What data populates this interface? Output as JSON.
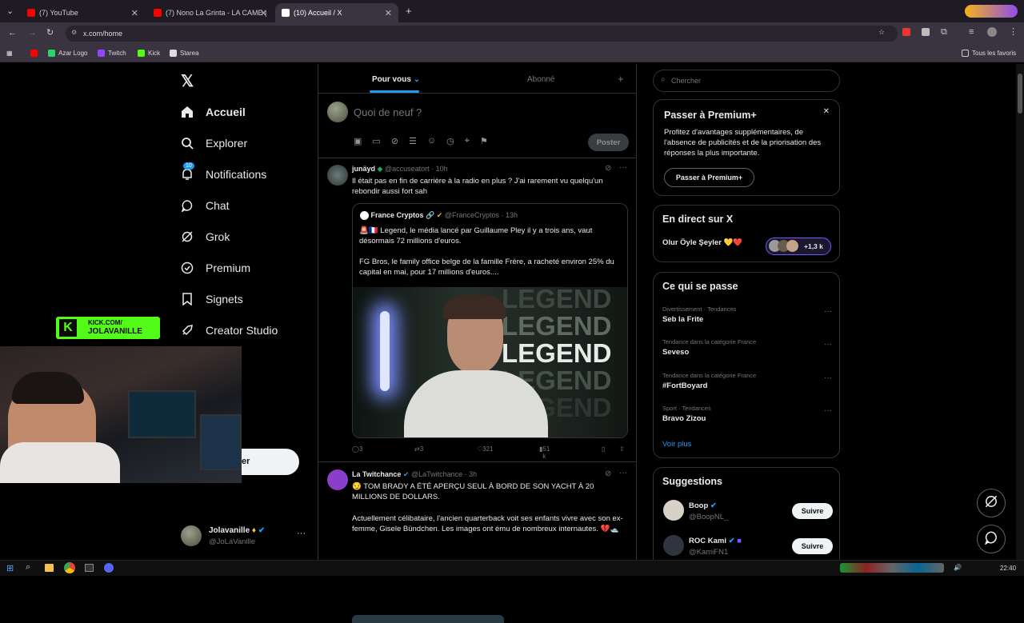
{
  "browser": {
    "tabs": [
      {
        "title": "(7) YouTube",
        "color": "#ff0000"
      },
      {
        "title": "(7) Nono La Grinta - LA CAME |",
        "color": "#ff0000"
      },
      {
        "title": "(10) Accueil / X",
        "color": "#ffffff"
      }
    ],
    "url": "x.com/home",
    "bookmarks": [
      "Azar Logo",
      "Twitch",
      "Kick",
      "Starea"
    ],
    "all_bookmarks": "Tous les favoris"
  },
  "nav": {
    "items": [
      {
        "label": "Accueil",
        "icon": "home-icon"
      },
      {
        "label": "Explorer",
        "icon": "search-icon"
      },
      {
        "label": "Notifications",
        "icon": "bell-icon",
        "badge": "10"
      },
      {
        "label": "Chat",
        "icon": "chat-icon"
      },
      {
        "label": "Grok",
        "icon": "grok-icon"
      },
      {
        "label": "Premium",
        "icon": "premium-icon"
      },
      {
        "label": "Signets",
        "icon": "bookmark-icon"
      },
      {
        "label": "Creator Studio",
        "icon": "rocket-icon"
      }
    ],
    "post_button_partial": "er",
    "account": {
      "name": "Jolavanille",
      "handle": "@JoLaVanille"
    }
  },
  "timeline": {
    "tabs": [
      "Pour vous",
      "Abonné"
    ],
    "compose_placeholder": "Quoi de neuf ?",
    "post_button": "Poster",
    "tweets": [
      {
        "name": "junäyd",
        "handle": "@accuseatort",
        "time": "· 10h",
        "text": "Il était pas en fin de carrière à la radio en plus ? J'ai rarement vu quelqu'un rebondir aussi fort sah",
        "quote": {
          "name": "France Cryptos",
          "handle": "@FranceCryptos",
          "time": "· 13h",
          "text1": "🚨🇫🇷 Legend, le média lancé par Guillaume Pley il y a trois ans, vaut désormais 72 millions d'euros.",
          "text2": "FG Bros, le family office belge de la famille Frère, a racheté environ 25% du capital en mai, pour 17 millions d'euros....",
          "image_words": [
            "LEGEND",
            "LEGEND",
            "LEGEND",
            "LEGEND",
            "LEGEND"
          ]
        },
        "stats": {
          "replies": "3",
          "retweets": "3",
          "likes": "321",
          "views": "51 k"
        }
      },
      {
        "name": "La Twitchance",
        "handle": "@LaTwitchance",
        "time": "· 3h",
        "text1": "😏 TOM BRADY A ÉTÉ APERÇU SEUL À BORD DE SON YACHT À 20 MILLIONS DE DOLLARS.",
        "text2": "Actuellement célibataire, l'ancien quarterback voit ses enfants vivre avec son ex-femme, Gisele Bündchen. Les images ont ému de nombreux internautes. 💔🛥️"
      }
    ]
  },
  "sidebar": {
    "search_placeholder": "Chercher",
    "premium": {
      "title": "Passer à Premium+",
      "text": "Profitez d'avantages supplémentaires, de l'absence de publicités et de la priorisation des réponses la plus importante.",
      "button": "Passer à Premium+"
    },
    "live": {
      "title": "En direct sur X",
      "item": "Olur Öyle Şeyler 💛❤️",
      "count": "+1,3 k"
    },
    "trends": {
      "title": "Ce qui se passe",
      "items": [
        {
          "meta": "Divertissement · Tendances",
          "name": "Seb la Frite"
        },
        {
          "meta": "Tendance dans la catégorie France",
          "name": "Seveso"
        },
        {
          "meta": "Tendance dans la catégorie France",
          "name": "#FortBoyard"
        },
        {
          "meta": "Sport · Tendances",
          "name": "Bravo Zizou"
        }
      ],
      "more": "Voir plus"
    },
    "suggestions": {
      "title": "Suggestions",
      "items": [
        {
          "name": "Boop",
          "handle": "@BoopNL_",
          "button": "Suivre"
        },
        {
          "name": "ROC Kami",
          "handle": "@KamiFN1",
          "button": "Suivre"
        }
      ]
    }
  },
  "overlay": {
    "kick_line1": "KICK.COM/",
    "kick_line2": "JOLAVANILLE"
  },
  "taskbar": {
    "time": "22:40"
  }
}
